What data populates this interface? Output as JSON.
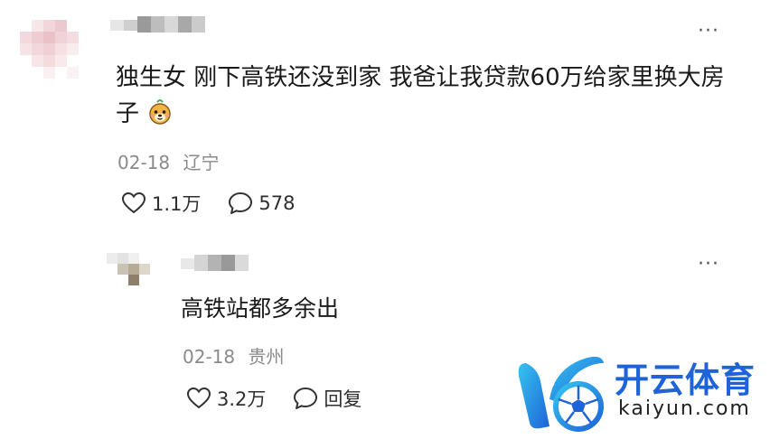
{
  "comment": {
    "text": "独生女 刚下高铁还没到家 我爸让我贷款60万给家里换大房子",
    "emoji": "dog-face-emoji",
    "date": "02-18",
    "location": "辽宁",
    "likes": "1.1万",
    "replies_count": "578",
    "more_glyph": "···"
  },
  "reply": {
    "text": "高铁站都多余出",
    "date": "02-18",
    "location": "贵州",
    "likes": "3.2万",
    "reply_label": "回复",
    "more_glyph": "···"
  },
  "watermark": {
    "brand_cn": "开云体育",
    "brand_en": "kaiyun.com"
  },
  "colors": {
    "text": "#1a1a1a",
    "meta": "#8a8a8a",
    "brand_blue": "#1e63d8",
    "brand_cyan": "#35c4ef"
  }
}
